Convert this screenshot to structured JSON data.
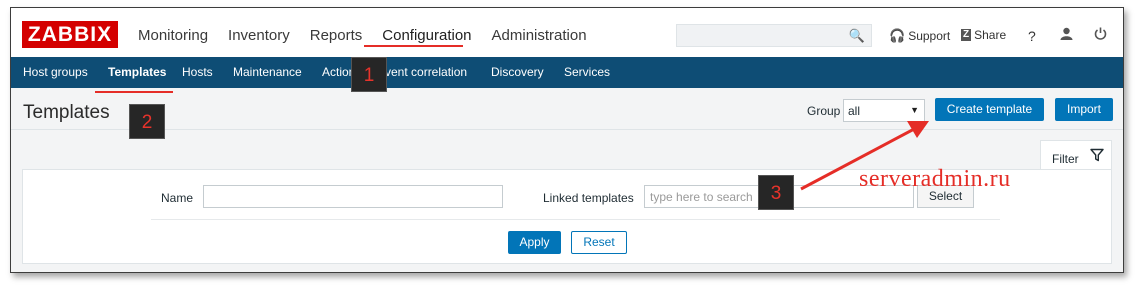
{
  "header": {
    "logo": "ZABBIX",
    "nav": [
      "Monitoring",
      "Inventory",
      "Reports",
      "Configuration",
      "Administration"
    ],
    "support": "Support",
    "share": "Share",
    "help": "?"
  },
  "subnav": [
    "Host groups",
    "Templates",
    "Hosts",
    "Maintenance",
    "Actions",
    "Event correlation",
    "Discovery",
    "Services"
  ],
  "page": {
    "title": "Templates",
    "group_label": "Group",
    "group_value": "all",
    "create_button": "Create template",
    "import_button": "Import"
  },
  "filter": {
    "tab_label": "Filter",
    "name_label": "Name",
    "name_value": "",
    "linked_label": "Linked templates",
    "linked_placeholder": "type here to search",
    "select_button": "Select",
    "apply_button": "Apply",
    "reset_button": "Reset"
  },
  "annotations": {
    "step1": "1",
    "step2": "2",
    "step3": "3",
    "watermark": "serveradmin.ru"
  },
  "colors": {
    "brand": "#d40000",
    "nav_bg": "#0e4d75",
    "primary": "#0275b8",
    "annotation": "#e52d27"
  }
}
